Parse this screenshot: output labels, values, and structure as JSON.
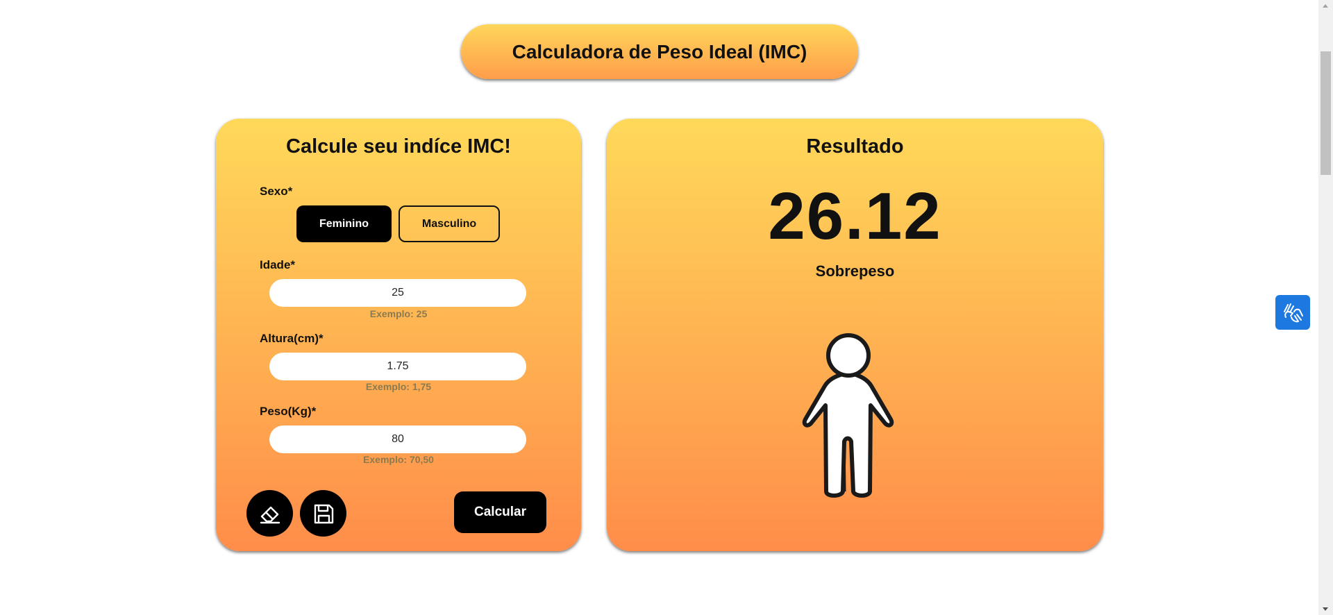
{
  "header": {
    "title": "Calculadora de Peso Ideal (IMC)"
  },
  "form": {
    "heading": "Calcule seu indíce IMC!",
    "sex_label": "Sexo*",
    "sex_options": {
      "female": "Feminino",
      "male": "Masculino"
    },
    "selected_sex": "Feminino",
    "age": {
      "label": "Idade*",
      "value": "25",
      "hint": "Exemplo: 25"
    },
    "height": {
      "label": "Altura(cm)*",
      "value": "1.75",
      "hint": "Exemplo: 1,75"
    },
    "weight": {
      "label": "Peso(Kg)*",
      "value": "80",
      "hint": "Exemplo: 70,50"
    },
    "buttons": {
      "clear_icon": "eraser-icon",
      "save_icon": "floppy-disk-icon",
      "calculate": "Calcular"
    }
  },
  "result": {
    "heading": "Resultado",
    "imc": "26.12",
    "classification": "Sobrepeso",
    "figure_icon": "body-figure-icon"
  },
  "accessibility": {
    "icon": "sign-language-hands-icon"
  },
  "colors": {
    "card_top": "#ffd95a",
    "card_bottom": "#ff8d4a",
    "accessibility_blue": "#1d78e0",
    "button_black": "#000000"
  }
}
